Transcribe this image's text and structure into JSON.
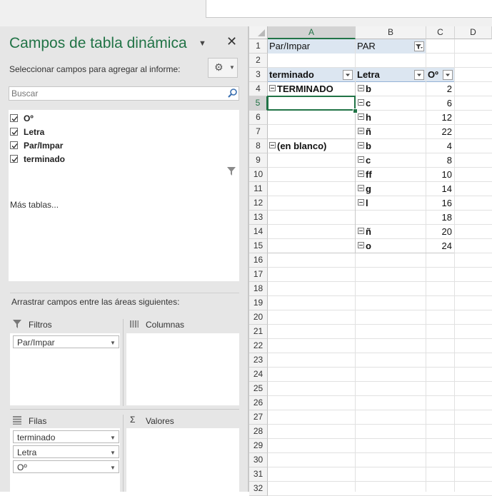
{
  "pane": {
    "title": "Campos de tabla dinámica",
    "subtitle": "Seleccionar campos para agregar al informe:",
    "search_placeholder": "Buscar",
    "fields": [
      {
        "label": "Oº",
        "checked": true
      },
      {
        "label": "Letra",
        "checked": true
      },
      {
        "label": "Par/Impar",
        "checked": true,
        "filtered": true
      },
      {
        "label": "terminado",
        "checked": true
      }
    ],
    "more_tables": "Más tablas...",
    "drag_hint": "Arrastrar campos entre las áreas siguientes:",
    "areas": {
      "filters": {
        "title": "Filtros",
        "items": [
          "Par/Impar"
        ]
      },
      "columns": {
        "title": "Columnas",
        "items": []
      },
      "rows": {
        "title": "Filas",
        "items": [
          "terminado",
          "Letra",
          "Oº"
        ]
      },
      "values": {
        "title": "Valores",
        "items": []
      }
    }
  },
  "sheet": {
    "columns": [
      "A",
      "B",
      "C",
      "D"
    ],
    "selected_column": "A",
    "selected_row": "5",
    "rows": [
      "1",
      "2",
      "3",
      "4",
      "5",
      "6",
      "7",
      "8",
      "9",
      "10",
      "11",
      "12",
      "13",
      "14",
      "15",
      "16",
      "17",
      "18",
      "19",
      "20",
      "21",
      "22",
      "23",
      "24",
      "25",
      "26",
      "27",
      "28",
      "29",
      "30",
      "31",
      "32"
    ],
    "filter": {
      "label": "Par/Impar",
      "value": "PAR"
    },
    "headers": {
      "a": "terminado",
      "b": "Letra",
      "c": "Oº"
    },
    "groups": [
      {
        "label": "TERMINADO",
        "row": 4
      },
      {
        "label": "(en blanco)",
        "row": 8
      }
    ],
    "letters": [
      {
        "row": 4,
        "value": "b"
      },
      {
        "row": 5,
        "value": "c"
      },
      {
        "row": 6,
        "value": "h"
      },
      {
        "row": 7,
        "value": "ñ"
      },
      {
        "row": 8,
        "value": "b"
      },
      {
        "row": 9,
        "value": "c"
      },
      {
        "row": 10,
        "value": "ff"
      },
      {
        "row": 11,
        "value": "g"
      },
      {
        "row": 12,
        "value": "l"
      },
      {
        "row": 14,
        "value": "ñ"
      },
      {
        "row": 15,
        "value": "o"
      }
    ],
    "numbers": [
      {
        "row": 4,
        "value": "2"
      },
      {
        "row": 5,
        "value": "6"
      },
      {
        "row": 6,
        "value": "12"
      },
      {
        "row": 7,
        "value": "22"
      },
      {
        "row": 8,
        "value": "4"
      },
      {
        "row": 9,
        "value": "8"
      },
      {
        "row": 10,
        "value": "10"
      },
      {
        "row": 11,
        "value": "14"
      },
      {
        "row": 12,
        "value": "16"
      },
      {
        "row": 13,
        "value": "18"
      },
      {
        "row": 14,
        "value": "20"
      },
      {
        "row": 15,
        "value": "24"
      }
    ],
    "accent_color": "#217346"
  }
}
